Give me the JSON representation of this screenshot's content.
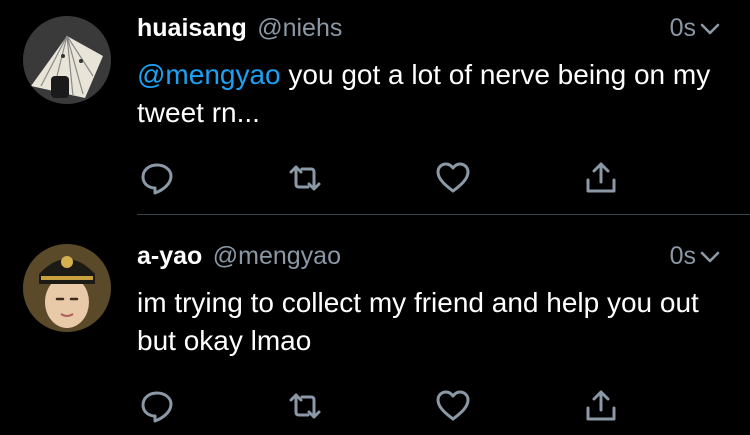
{
  "tweets": [
    {
      "display_name": "huaisang",
      "handle": "@niehs",
      "time": "0s",
      "mention": "@mengyao",
      "text": " you got a lot of nerve being on my tweet rn..."
    },
    {
      "display_name": "a-yao",
      "handle": "@mengyao",
      "time": "0s",
      "mention": "",
      "text": "im trying to collect my friend and help you out but okay lmao"
    }
  ],
  "icons": {
    "reply": "reply-icon",
    "retweet": "retweet-icon",
    "like": "heart-icon",
    "share": "share-icon",
    "caret": "chevron-down-icon"
  },
  "colors": {
    "background": "#000000",
    "text": "#ffffff",
    "muted": "#8b98a5",
    "link": "#1da1f2",
    "divider": "#38444d"
  }
}
